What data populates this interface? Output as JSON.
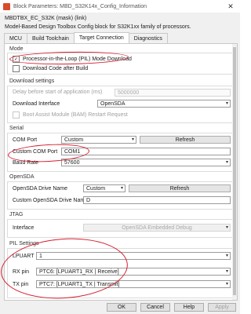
{
  "window": {
    "title": "Block Parameters: MBD_S32K14x_Config_Information",
    "close_glyph": "✕"
  },
  "block": {
    "name": "MBDTBX_EC_S32K (mask) (link)",
    "description": "Model-Based Design Toolbox Config block for S32K1xx family of processors."
  },
  "tabs": [
    {
      "label": "MCU"
    },
    {
      "label": "Build Toolchain"
    },
    {
      "label": "Target Connection"
    },
    {
      "label": "Diagnostics"
    }
  ],
  "mode": {
    "group_label": "Mode",
    "pil": {
      "label": "Processor-in-the-Loop (PIL) Mode Download",
      "checked": true
    },
    "download_after_build": {
      "label": "Download Code after Build",
      "checked": false
    }
  },
  "download": {
    "group_label": "Download settings",
    "delay_label": "Delay before start of application (ms)",
    "delay_value": "5000000",
    "interface_label": "Download Interface",
    "interface_value": "OpenSDA",
    "bam_label": "Boot Assist Module (BAM) Restart Request"
  },
  "serial": {
    "group_label": "Serial",
    "com_port_label": "COM Port",
    "com_port_value": "Custom",
    "refresh_label": "Refresh",
    "custom_com_label": "Custom COM Port",
    "custom_com_value": "COM1",
    "baud_label": "Baud Rate",
    "baud_value": "57600"
  },
  "opensda": {
    "group_label": "OpenSDA",
    "drive_label": "OpenSDA Drive Name",
    "drive_value": "Custom",
    "refresh_label": "Refresh",
    "custom_drive_label": "Custom OpenSDA Drive Name",
    "custom_drive_value": "D"
  },
  "jtag": {
    "group_label": "JTAG",
    "interface_label": "Interface",
    "interface_value": "OpenSDA Embedded Debug"
  },
  "pil_settings": {
    "group_label": "PIL Settings",
    "lpuart_label": "LPUART",
    "lpuart_value": "1",
    "rx_label": "RX pin",
    "rx_value": "PTC6: [LPUART1_RX | Receive]",
    "tx_label": "TX pin",
    "tx_value": "PTC7: [LPUART1_TX | Transmit]"
  },
  "footer": {
    "ok": "OK",
    "cancel": "Cancel",
    "help": "Help",
    "apply": "Apply"
  },
  "colors": {
    "annotation": "#d41e2e",
    "panel_bg": "#ffffff",
    "window_bg": "#f0f0f0"
  },
  "icons": {
    "app": "simulink-block-icon",
    "caret": "chevron-down-icon"
  }
}
